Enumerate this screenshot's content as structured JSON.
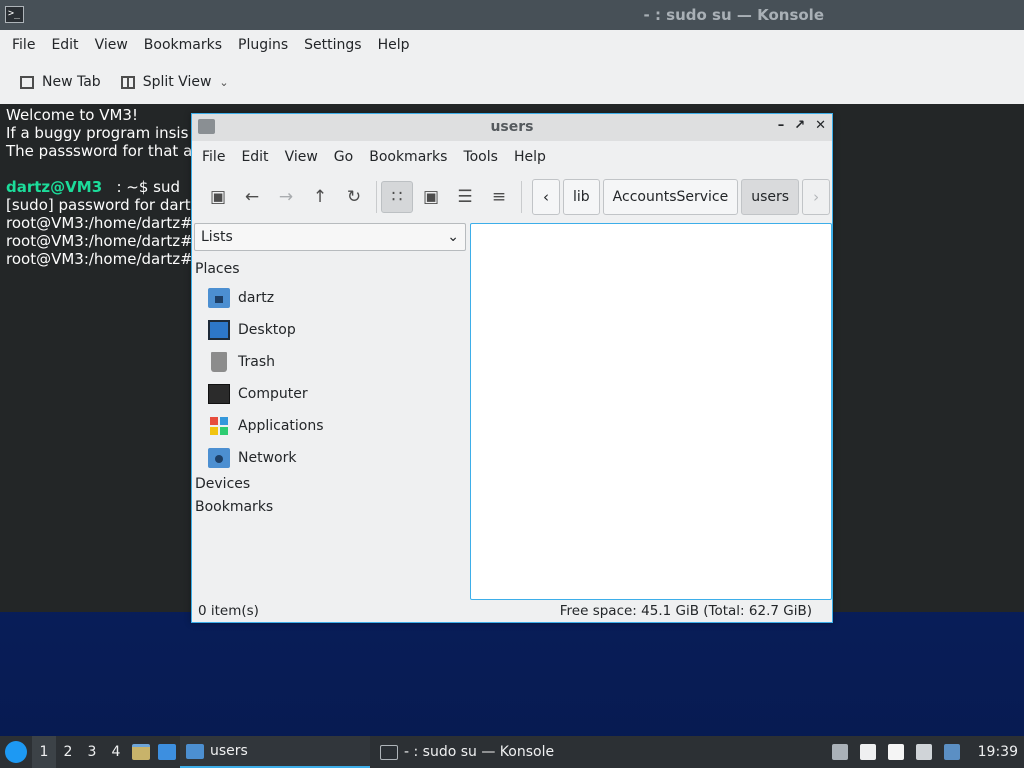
{
  "konsole": {
    "title": "- : sudo su — Konsole",
    "menu": [
      "File",
      "Edit",
      "View",
      "Bookmarks",
      "Plugins",
      "Settings",
      "Help"
    ],
    "toolbar": {
      "new_tab": "New Tab",
      "split_view": "Split View"
    },
    "terminal": {
      "line1": "Welcome to VM3!",
      "line2": "If a buggy program insis",
      "line3": "The passsword for that a",
      "prompt_user": "dartz@VM3",
      "prompt_rest": "   : ~$ sud",
      "line5": "[sudo] password for dart",
      "line6": "root@VM3:/home/dartz#",
      "line7": "root@VM3:/home/dartz#",
      "line8": "root@VM3:/home/dartz#"
    }
  },
  "filemanager": {
    "title": "users",
    "menu": [
      "File",
      "Edit",
      "View",
      "Go",
      "Bookmarks",
      "Tools",
      "Help"
    ],
    "breadcrumbs": [
      "lib",
      "AccountsService",
      "users"
    ],
    "side_select": "Lists",
    "places_heading": "Places",
    "places": [
      {
        "label": "dartz",
        "icon": "home-folder-icon"
      },
      {
        "label": "Desktop",
        "icon": "desktop-icon"
      },
      {
        "label": "Trash",
        "icon": "trash-icon"
      },
      {
        "label": "Computer",
        "icon": "computer-icon"
      },
      {
        "label": "Applications",
        "icon": "applications-icon"
      },
      {
        "label": "Network",
        "icon": "network-icon"
      }
    ],
    "devices_heading": "Devices",
    "bookmarks_heading": "Bookmarks",
    "status_items": "0 item(s)",
    "status_space": "Free space: 45.1 GiB (Total: 62.7 GiB)"
  },
  "taskbar": {
    "desktops": [
      "1",
      "2",
      "3",
      "4"
    ],
    "tasks": [
      {
        "label": "users"
      },
      {
        "label": "- : sudo su — Konsole"
      }
    ],
    "clock": "19:39"
  },
  "colors": {
    "accent": "#3daee9",
    "terminal_bg": "#232627",
    "prompt_user": "#1cdc9a",
    "desktop_bg": "#0a2468",
    "taskbar_bg": "#2c3034"
  }
}
